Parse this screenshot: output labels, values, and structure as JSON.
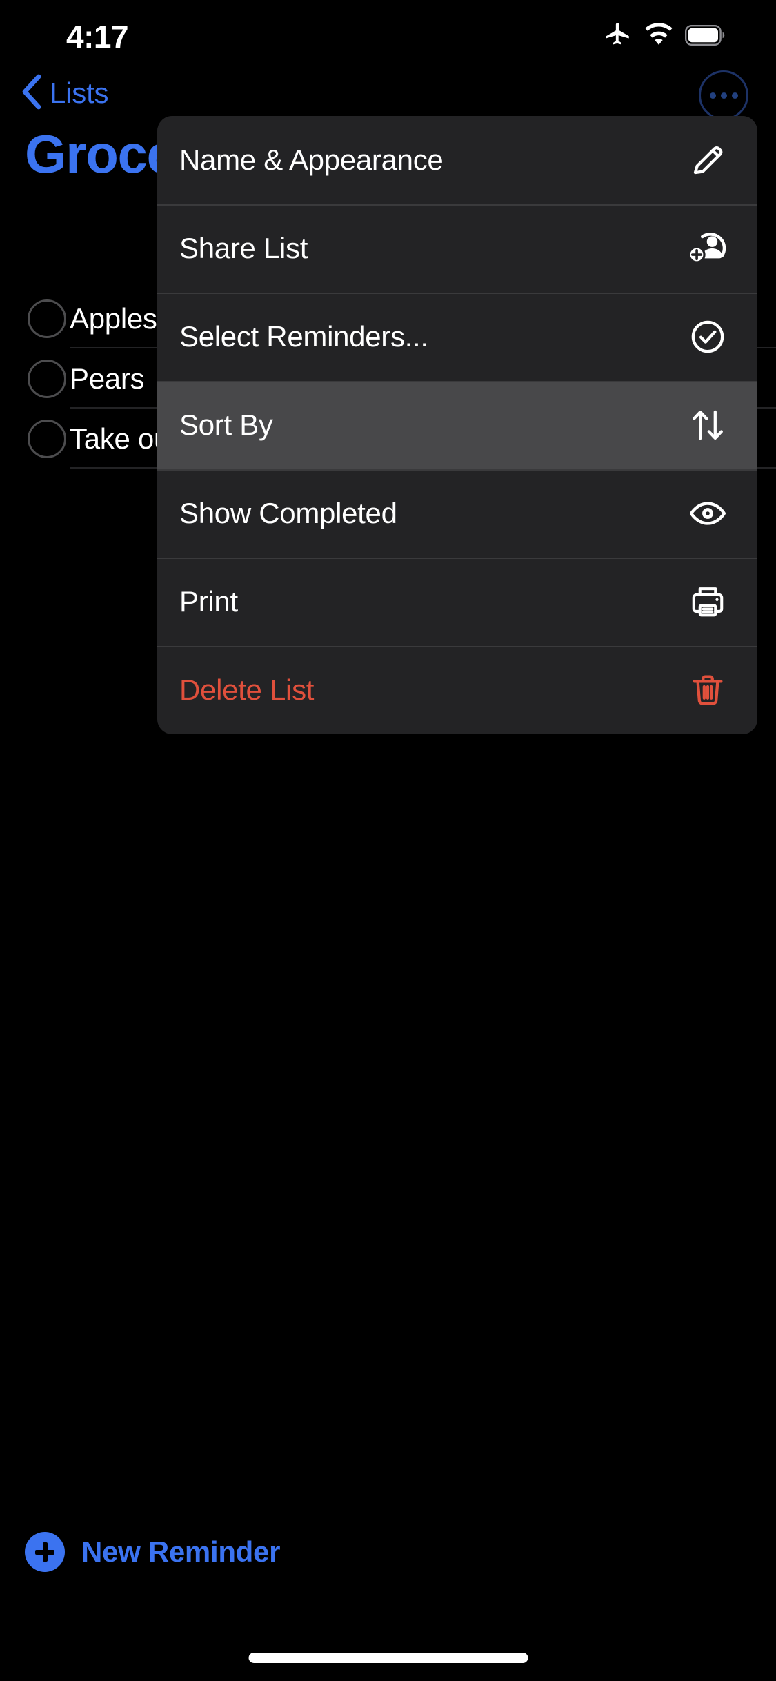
{
  "status_bar": {
    "time": "4:17",
    "icons": [
      "airplane-mode-icon",
      "wifi-icon",
      "battery-icon"
    ]
  },
  "nav_bar": {
    "back_label": "Lists",
    "back_icon": "chevron-left-icon",
    "more_icon": "ellipsis-circle-icon"
  },
  "list": {
    "title": "Groceries",
    "accent_color": "#3b73f0",
    "reminders": [
      {
        "title": "Apples",
        "completed": false
      },
      {
        "title": "Pears",
        "completed": false
      },
      {
        "title": "Take out",
        "completed": false
      }
    ]
  },
  "context_menu": {
    "items": [
      {
        "label": "Name & Appearance",
        "icon": "pencil-icon",
        "highlighted": false,
        "destructive": false
      },
      {
        "label": "Share List",
        "icon": "person-badge-plus-icon",
        "highlighted": false,
        "destructive": false
      },
      {
        "label": "Select Reminders...",
        "icon": "checkmark-circle-icon",
        "highlighted": false,
        "destructive": false
      },
      {
        "label": "Sort By",
        "icon": "arrow-up-arrow-down-icon",
        "highlighted": true,
        "destructive": false
      },
      {
        "label": "Show Completed",
        "icon": "eye-icon",
        "highlighted": false,
        "destructive": false
      },
      {
        "label": "Print",
        "icon": "printer-icon",
        "highlighted": false,
        "destructive": false
      },
      {
        "label": "Delete List",
        "icon": "trash-icon",
        "highlighted": false,
        "destructive": true
      }
    ],
    "destructive_color": "#e0503c",
    "highlight_color": "#48484a",
    "background_color": "#232325"
  },
  "footer": {
    "new_reminder_label": "New Reminder",
    "new_reminder_icon": "plus-circle-icon"
  }
}
